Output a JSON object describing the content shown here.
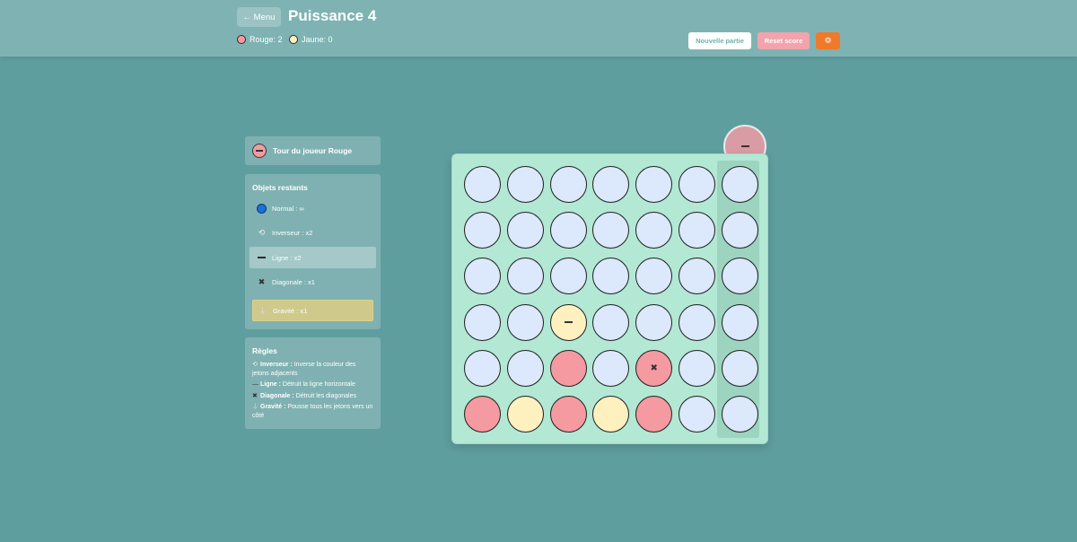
{
  "header": {
    "menu_label": "← Menu",
    "title": "Puissance 4",
    "score_red": "Rouge: 2",
    "score_yellow": "Jaune: 0",
    "new_game_label": "Nouvelle partie",
    "reset_label": "Reset score",
    "settings_icon": "gear-icon"
  },
  "turn": {
    "label": "Tour du joueur Rouge",
    "player_color": "#f59aa1"
  },
  "objects": {
    "heading": "Objets restants",
    "items": [
      {
        "icon": "normal-token-icon",
        "label": "Normal : ∞"
      },
      {
        "icon": "inverseur-icon",
        "label": "Inverseur : x2"
      },
      {
        "icon": "ligne-icon",
        "label": "Ligne : x2",
        "selected": true
      },
      {
        "icon": "diagonale-icon",
        "label": "Diagonale : x1"
      },
      {
        "icon": "gravite-icon",
        "label": "Gravité : x1"
      }
    ]
  },
  "rules": {
    "heading": "Règles",
    "items": [
      {
        "name": "Inverseur :",
        "text": " Inverse la couleur des jetons adjacents"
      },
      {
        "name": "Ligne :",
        "text": " Détruit la ligne horizontale"
      },
      {
        "name": "Diagonale :",
        "text": " Détruit les diagonales"
      },
      {
        "name": "Gravité :",
        "text": " Pousse tous les jetons vers un côté"
      }
    ]
  },
  "colors": {
    "red": "#f59aa1",
    "yellow": "#fff0c0",
    "empty": "#dce8fb",
    "board": "#b2e8d4"
  },
  "board": {
    "rows": 6,
    "cols": 7,
    "hover_column": 7,
    "cells": [
      [
        "empty",
        "empty",
        "empty",
        "empty",
        "empty",
        "empty",
        "empty"
      ],
      [
        "empty",
        "empty",
        "empty",
        "empty",
        "empty",
        "empty",
        "empty"
      ],
      [
        "empty",
        "empty",
        "empty",
        "empty",
        "empty",
        "empty",
        "empty"
      ],
      [
        "empty",
        "empty",
        "yellow:ligne",
        "empty",
        "empty",
        "empty",
        "empty"
      ],
      [
        "empty",
        "empty",
        "red",
        "empty",
        "red:diagonale",
        "empty",
        "empty"
      ],
      [
        "red",
        "yellow",
        "red",
        "yellow",
        "red",
        "empty",
        "empty"
      ]
    ]
  }
}
